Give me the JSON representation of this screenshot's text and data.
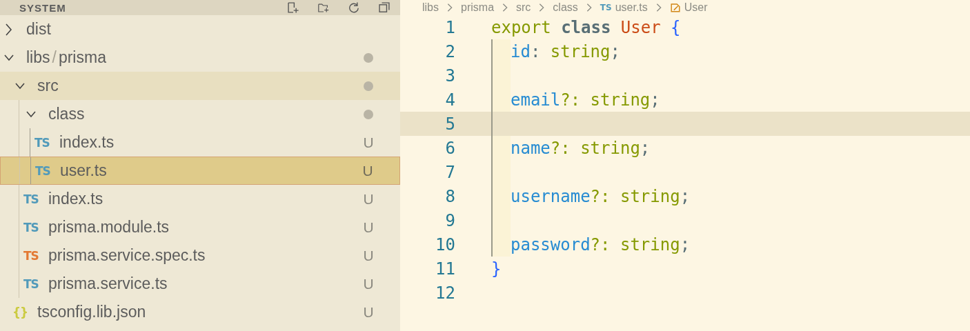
{
  "explorer": {
    "title": "SYSTEM",
    "tree": [
      {
        "kind": "folder",
        "name": "dist",
        "expanded": false,
        "has_changes": false,
        "hovered": false,
        "selected": false
      },
      {
        "kind": "folder",
        "name_parts": [
          "libs",
          "prisma"
        ],
        "separator": "/",
        "expanded": true,
        "has_changes": true,
        "hovered": false,
        "selected": false,
        "children": [
          {
            "kind": "folder",
            "name": "src",
            "expanded": true,
            "has_changes": true,
            "hovered": true,
            "selected": false,
            "children": [
              {
                "kind": "folder",
                "name": "class",
                "expanded": true,
                "has_changes": true,
                "hovered": false,
                "selected": false,
                "children": [
                  {
                    "kind": "file",
                    "name": "index.ts",
                    "icon": "TS",
                    "color": "#519aba",
                    "badge": "U",
                    "hovered": false,
                    "selected": false
                  },
                  {
                    "kind": "file",
                    "name": "user.ts",
                    "icon": "TS",
                    "color": "#519aba",
                    "badge": "U",
                    "hovered": false,
                    "selected": true
                  }
                ]
              },
              {
                "kind": "file",
                "name": "index.ts",
                "icon": "TS",
                "color": "#519aba",
                "badge": "U",
                "hovered": false,
                "selected": false
              },
              {
                "kind": "file",
                "name": "prisma.module.ts",
                "icon": "TS",
                "color": "#519aba",
                "badge": "U",
                "hovered": false,
                "selected": false
              },
              {
                "kind": "file",
                "name": "prisma.service.spec.ts",
                "icon": "TS",
                "color": "#e37933",
                "badge": "U",
                "hovered": false,
                "selected": false
              },
              {
                "kind": "file",
                "name": "prisma.service.ts",
                "icon": "TS",
                "color": "#519aba",
                "badge": "U",
                "hovered": false,
                "selected": false
              }
            ]
          },
          {
            "kind": "file",
            "name": "tsconfig.lib.json",
            "icon": "{}",
            "color": "#cbcb41",
            "badge": "U",
            "hovered": false,
            "selected": false
          }
        ]
      }
    ]
  },
  "breadcrumbs": [
    {
      "kind": "folder",
      "label": "libs"
    },
    {
      "kind": "folder",
      "label": "prisma"
    },
    {
      "kind": "folder",
      "label": "src"
    },
    {
      "kind": "folder",
      "label": "class"
    },
    {
      "kind": "file",
      "label": "user.ts",
      "icon": "TS"
    },
    {
      "kind": "symbol",
      "label": "User"
    }
  ],
  "editor": {
    "lines": [
      {
        "number": "1",
        "indented": false,
        "current": false,
        "tokens": [
          {
            "kind": "keyword",
            "text": "export"
          },
          {
            "kind": "storage",
            "text": " class"
          },
          {
            "kind": "class-name",
            "text": " User"
          },
          {
            "kind": "brace",
            "text": " {"
          }
        ]
      },
      {
        "number": "2",
        "indented": true,
        "current": false,
        "tokens": [
          {
            "kind": "property",
            "text": "id"
          },
          {
            "kind": "punct",
            "text": ": "
          },
          {
            "kind": "type",
            "text": "string"
          },
          {
            "kind": "punct",
            "text": ";"
          }
        ]
      },
      {
        "number": "3",
        "indented": true,
        "current": false
      },
      {
        "number": "4",
        "indented": true,
        "current": false,
        "tokens": [
          {
            "kind": "property",
            "text": "email"
          },
          {
            "kind": "type",
            "text": "?: string"
          },
          {
            "kind": "punct",
            "text": ";"
          }
        ]
      },
      {
        "number": "5",
        "indented": true,
        "current": true
      },
      {
        "number": "6",
        "indented": true,
        "current": false,
        "tokens": [
          {
            "kind": "property",
            "text": "name"
          },
          {
            "kind": "type",
            "text": "?: string"
          },
          {
            "kind": "punct",
            "text": ";"
          }
        ]
      },
      {
        "number": "7",
        "indented": true,
        "current": false
      },
      {
        "number": "8",
        "indented": true,
        "current": false,
        "tokens": [
          {
            "kind": "property",
            "text": "username"
          },
          {
            "kind": "type",
            "text": "?: string"
          },
          {
            "kind": "punct",
            "text": ";"
          }
        ]
      },
      {
        "number": "9",
        "indented": true,
        "current": false
      },
      {
        "number": "10",
        "indented": true,
        "current": false,
        "tokens": [
          {
            "kind": "property",
            "text": "password"
          },
          {
            "kind": "type",
            "text": "?: string"
          },
          {
            "kind": "punct",
            "text": ";"
          }
        ]
      },
      {
        "number": "11",
        "indented": false,
        "current": false,
        "tokens": [
          {
            "kind": "brace",
            "text": "}"
          }
        ]
      },
      {
        "number": "12",
        "indented": false,
        "current": false
      }
    ]
  }
}
